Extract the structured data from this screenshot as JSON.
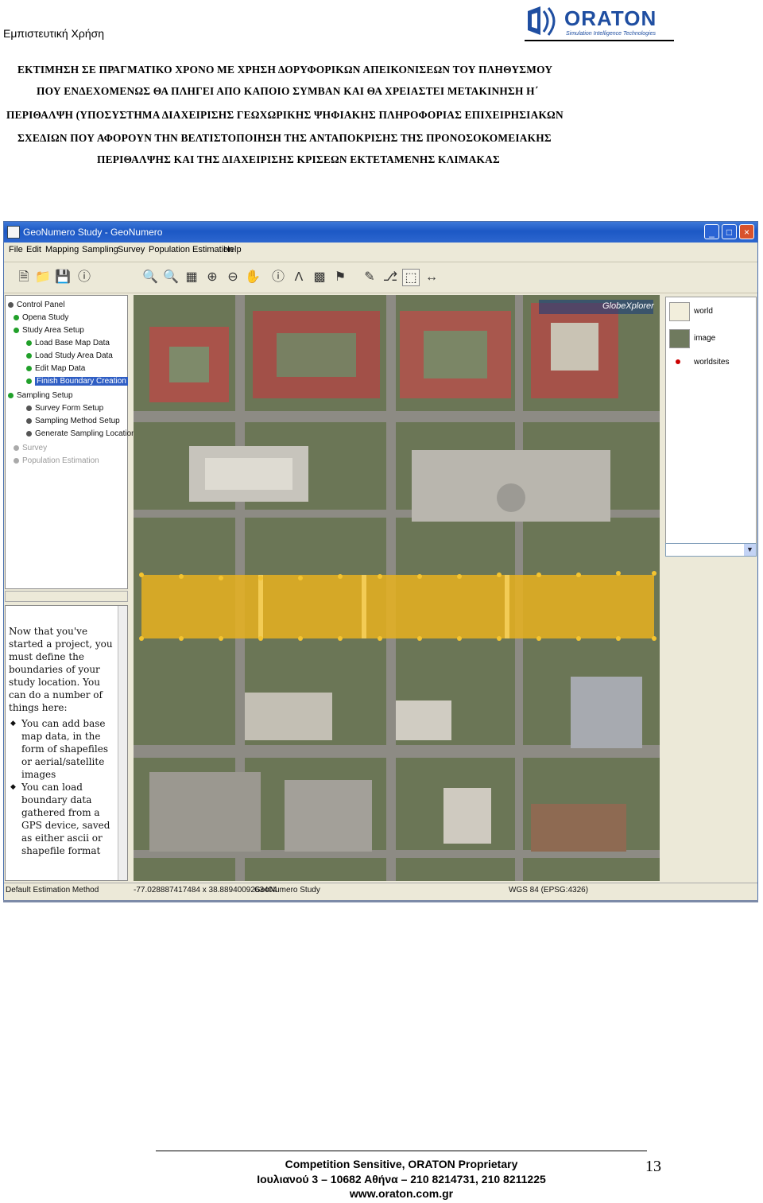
{
  "header": {
    "confidential": "Εμπιστευτική Χρήση",
    "logo_text": "ORATON",
    "logo_tagline": "Simulation Intelligence Technologies"
  },
  "title_lines": [
    "ΕΚΤΙΜΗΣΗ ΣΕ ΠΡΑΓΜΑΤΙΚΟ ΧΡΟΝΟ ΜΕ ΧΡΗΣΗ ΔΟΡΥΦΟΡΙΚΩΝ ΑΠΕΙΚΟΝΙΣΕΩΝ ΤΟΥ ΠΛΗΘΥΣΜΟΥ",
    "ΠΟΥ ΕΝΔΕΧΟΜΕΝΩΣ ΘΑ ΠΛΗΓΕΙ ΑΠΟ ΚΑΠΟΙΟ ΣΥΜΒΑΝ ΚΑΙ ΘΑ ΧΡΕΙΑΣΤΕΙ ΜΕΤΑΚΙΝΗΣΗ Η΄",
    "ΠΕΡΙΘΑΛΨΗ  (ΥΠΟΣΥΣΤΗΜΑ ΔΙΑΧΕΙΡΙΣΗΣ ΓΕΩΧΩΡΙΚΗΣ ΨΗΦΙΑΚΗΣ ΠΛΗΡΟΦΟΡΙΑΣ ΕΠΙΧΕΙΡΗΣΙΑΚΩΝ",
    "ΣΧΕΔΙΩΝ ΠΟΥ ΑΦΟΡΟΥΝ ΤΗΝ ΒΕΛΤΙΣΤΟΠΟΙΗΣΗ ΤΗΣ ΑΝΤΑΠΟΚΡΙΣΗΣ ΤΗΣ ΠΡΟΝΟΣΟΚΟΜΕΙΑΚΗΣ",
    "ΠΕΡΙΘΑΛΨΗΣ ΚΑΙ ΤΗΣ ΔΙΑΧΕΙΡΙΣΗΣ ΚΡΙΣΕΩΝ ΕΚΤΕΤΑΜΕΝΗΣ ΚΛΙΜΑΚΑΣ"
  ],
  "app": {
    "window_title": "GeoNumero Study - GeoNumero",
    "window_buttons": [
      "_",
      "□",
      "×"
    ],
    "menu": [
      "File",
      "Edit",
      "Mapping",
      "Sampling",
      "Survey",
      "Population Estimation",
      "Help"
    ],
    "toolbar_icons": [
      "new-file-icon",
      "open-folder-icon",
      "save-icon",
      "help-icon",
      "zoom-extent-icon",
      "zoom-layer-icon",
      "zoom-selection-icon",
      "zoom-in-icon",
      "zoom-out-icon",
      "pan-icon",
      "info-icon",
      "measure-icon",
      "image-icon",
      "flag-icon",
      "pencil-icon",
      "boundary-tool-icon",
      "select-tool-icon",
      "arrow-icon"
    ],
    "tree": [
      {
        "label": "Control Panel",
        "level": 0,
        "dot": "dk"
      },
      {
        "label": "Opena Study",
        "level": 1,
        "dot": "green"
      },
      {
        "label": "Study Area Setup",
        "level": 1,
        "dot": "green"
      },
      {
        "label": "Load Base Map Data",
        "level": 2,
        "dot": "green"
      },
      {
        "label": "Load Study Area Data",
        "level": 2,
        "dot": "green"
      },
      {
        "label": "Edit Map Data",
        "level": 2,
        "dot": "green"
      },
      {
        "label": "Finish Boundary Creation",
        "level": 2,
        "dot": "green",
        "highlight": true
      },
      {
        "label": "Sampling Setup",
        "level": 0,
        "dot": "green"
      },
      {
        "label": "Survey Form Setup",
        "level": 2,
        "dot": "dk"
      },
      {
        "label": "Sampling Method Setup",
        "level": 2,
        "dot": "dk"
      },
      {
        "label": "Generate Sampling Locations",
        "level": 2,
        "dot": "dk"
      },
      {
        "label": "Survey",
        "level": 1,
        "dot": "gray",
        "dim": true
      },
      {
        "label": "Population Estimation",
        "level": 1,
        "dot": "gray",
        "dim": true
      }
    ],
    "help_intro": "Now that you've started a project, you must define the boundaries of your study location. You can do a number of things here:",
    "help_bullets": [
      "You can add base map data, in the form of shapefiles or aerial/satellite images",
      "You can load boundary data gathered from a GPS device, saved as either ascii or shapefile format"
    ],
    "map_badge": "GlobeXplorer",
    "layers": [
      "world",
      "image",
      "worldsites"
    ],
    "status_left": "Default Estimation Method",
    "status_coords": "-77.028887417484 x 38.8894009263404",
    "status_center": "GeoNumero Study",
    "status_right": "WGS 84 (EPSG:4326)"
  },
  "footer": {
    "line1": "Competition Sensitive, ORATON Proprietary",
    "line2": "Ιουλιανού 3 – 10682 Αθήνα –  210 8214731, 210 8211225",
    "line3": "www.oraton.com.gr",
    "page_number": "13"
  },
  "colors": {
    "brand": "#1f4ea1",
    "titlebar": "#1c58c5",
    "boundary_fill": "#e8b21f",
    "selection": "#2f5ec4"
  }
}
